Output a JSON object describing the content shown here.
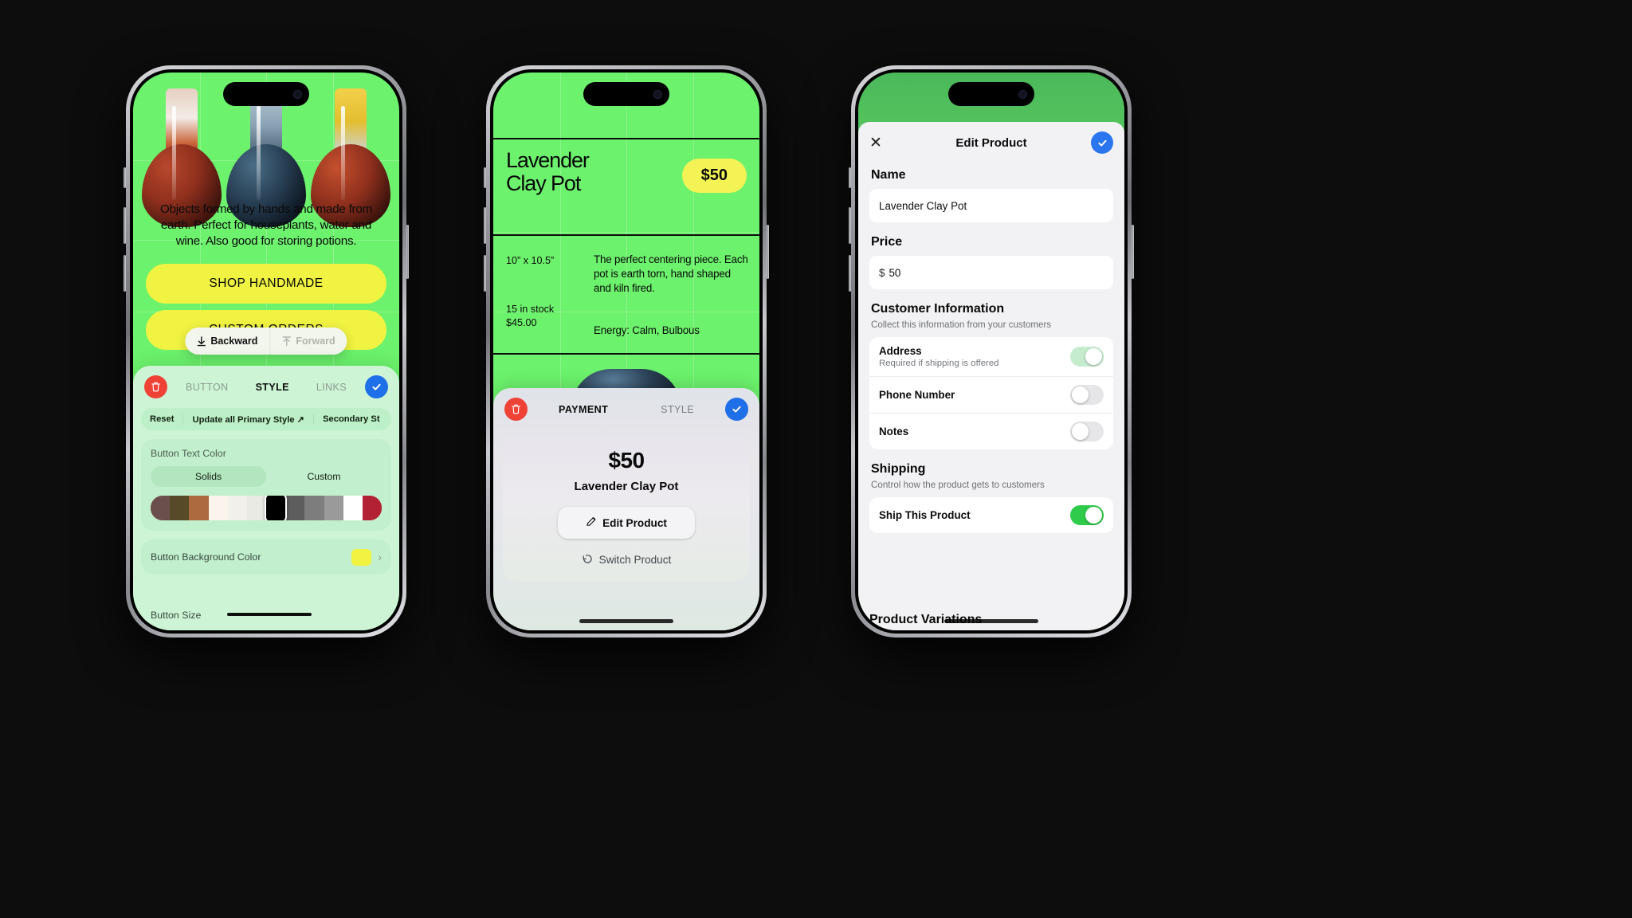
{
  "phone1": {
    "hero": {
      "description": "Objects formed by hands and made from earth. Perfect for houseplants, water and wine. Also good for storing potions.",
      "cta_primary": "SHOP HANDMADE",
      "cta_secondary": "CUSTOM ORDERS"
    },
    "navpill": {
      "backward": "Backward",
      "forward": "Forward"
    },
    "panel": {
      "delete_icon": "trash-icon",
      "confirm_icon": "check-icon",
      "tabs": [
        {
          "label": "BUTTON",
          "active": false
        },
        {
          "label": "STYLE",
          "active": true
        },
        {
          "label": "LINKS",
          "active": false
        }
      ],
      "subbar": [
        "Reset",
        "Update all Primary Style ↗",
        "Secondary St"
      ],
      "text_color": {
        "title": "Button Text Color",
        "options": [
          {
            "label": "Solids",
            "selected": true
          },
          {
            "label": "Custom",
            "selected": false
          }
        ],
        "swatches": [
          "#6b4f4c",
          "#574a29",
          "#ad6a3f",
          "#fbf4ec",
          "#f2f0ea",
          "#e9eae4",
          "#000000",
          "#5d5d5d",
          "#7d7d7d",
          "#9a9a9a",
          "#ffffff",
          "#b22234"
        ],
        "selected_swatch": "#000000"
      },
      "bg_color": {
        "label": "Button Background Color",
        "swatch": "#f0f341",
        "chevron": "›"
      },
      "size": {
        "label": "Button Size"
      }
    },
    "colors": {
      "screen_bg": "#6cf26c",
      "panel_bg": "#cdf5d5",
      "yellow": "#f0f341",
      "red": "#ef4236",
      "blue": "#1f6fe8"
    }
  },
  "phone2": {
    "product": {
      "title": "Lavender\nClay Pot",
      "price_pill": "$50",
      "dimensions": "10” x 10.5”",
      "stock": "15 in stock",
      "cost": "$45.00",
      "description": "The perfect centering piece. Each pot is earth torn, hand shaped and kiln fired.",
      "energy": "Energy: Calm, Bulbous"
    },
    "sheet": {
      "delete_icon": "trash-icon",
      "confirm_icon": "check-icon",
      "tabs": [
        {
          "label": "PAYMENT",
          "active": true
        },
        {
          "label": "STYLE",
          "active": false
        }
      ],
      "amount": "$50",
      "product_name": "Lavender Clay Pot",
      "edit_button": "Edit Product",
      "edit_icon": "pencil-icon",
      "switch_button": "Switch Product",
      "switch_icon": "undo-icon"
    },
    "colors": {
      "screen_bg": "#6cf26c",
      "pill_yellow": "#f3f355",
      "red": "#ef4236",
      "blue": "#1f6fe8"
    }
  },
  "phone3": {
    "header": {
      "title": "Edit Product",
      "close_icon": "close-icon",
      "confirm_icon": "check-icon"
    },
    "name": {
      "label": "Name",
      "value": "Lavender Clay Pot"
    },
    "price": {
      "label": "Price",
      "currency": "$",
      "value": "50"
    },
    "customer_information": {
      "title": "Customer Information",
      "subtitle": "Collect this information from your customers",
      "rows": [
        {
          "label": "Address",
          "sublabel": "Required if shipping is offered",
          "state": "mid"
        },
        {
          "label": "Phone Number",
          "sublabel": "",
          "state": "off"
        },
        {
          "label": "Notes",
          "sublabel": "",
          "state": "off"
        }
      ]
    },
    "shipping": {
      "title": "Shipping",
      "subtitle": "Control how the product gets to customers",
      "rows": [
        {
          "label": "Ship This Product",
          "sublabel": "",
          "state": "on"
        }
      ]
    },
    "variations": {
      "title": "Product Variations"
    },
    "colors": {
      "screen_bg": "#57c45d",
      "modal_bg": "#f2f2f4",
      "blue": "#2b76ee",
      "green": "#2ecc4a"
    }
  }
}
